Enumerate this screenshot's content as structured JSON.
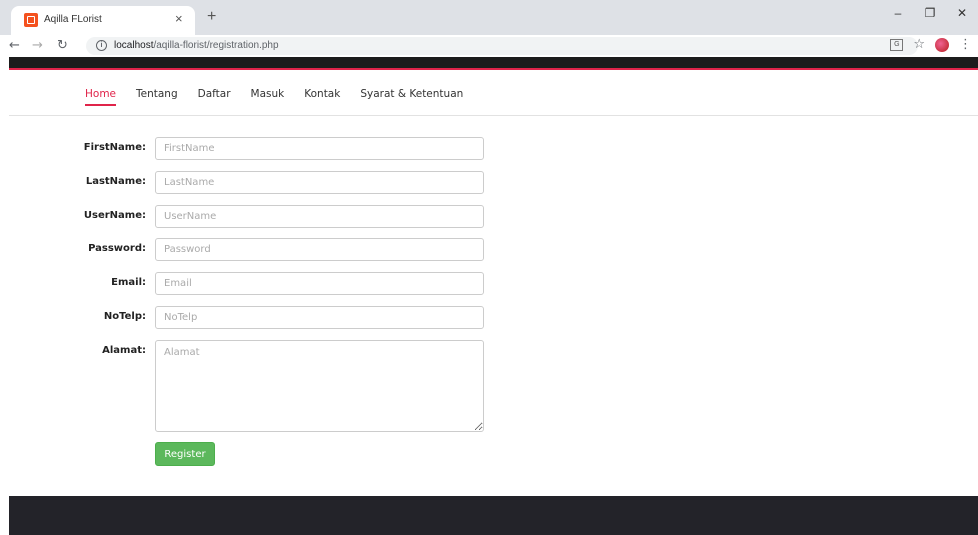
{
  "browser": {
    "tab_title": "Aqilla FLorist",
    "tab_close": "×",
    "new_tab": "+",
    "url_host": "localhost",
    "url_path": "/aqilla-florist/registration.php",
    "info_glyph": "i"
  },
  "nav": {
    "items": [
      {
        "label": "Home",
        "active": true
      },
      {
        "label": "Tentang"
      },
      {
        "label": "Daftar"
      },
      {
        "label": "Masuk"
      },
      {
        "label": "Kontak"
      },
      {
        "label": "Syarat & Ketentuan"
      }
    ]
  },
  "form": {
    "firstname": {
      "label": "FirstName:",
      "placeholder": "FirstName"
    },
    "lastname": {
      "label": "LastName:",
      "placeholder": "LastName"
    },
    "username": {
      "label": "UserName:",
      "placeholder": "UserName"
    },
    "password": {
      "label": "Password:",
      "placeholder": "Password"
    },
    "email": {
      "label": "Email:",
      "placeholder": "Email"
    },
    "notelp": {
      "label": "NoTelp:",
      "placeholder": "NoTelp"
    },
    "alamat": {
      "label": "Alamat:",
      "placeholder": "Alamat"
    },
    "submit_label": "Register"
  },
  "colors": {
    "accent": "#e0244a",
    "button": "#5cb85c",
    "footer": "#232329"
  }
}
